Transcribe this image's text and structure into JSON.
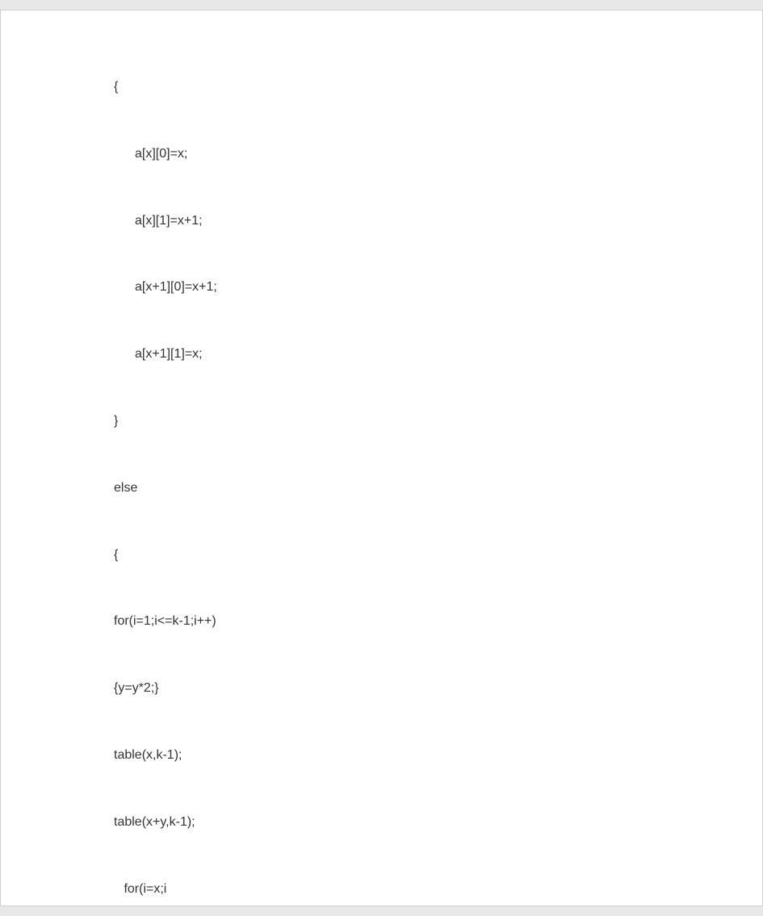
{
  "code": {
    "lines": [
      {
        "text": "{",
        "indent": "indent-0"
      },
      {
        "text": "a[x][0]=x;",
        "indent": "indent-1"
      },
      {
        "text": "a[x][1]=x+1;",
        "indent": "indent-1"
      },
      {
        "text": "a[x+1][0]=x+1;",
        "indent": "indent-1"
      },
      {
        "text": "a[x+1][1]=x;",
        "indent": "indent-1"
      },
      {
        "text": "}",
        "indent": "indent-0"
      },
      {
        "text": "else",
        "indent": "indent-0"
      },
      {
        "text": "{",
        "indent": "indent-0"
      },
      {
        "text": "for(i=1;i<=k-1;i++)",
        "indent": "indent-0"
      },
      {
        "text": "{y=y*2;}",
        "indent": "indent-0"
      },
      {
        "text": "table(x,k-1);",
        "indent": "indent-0"
      },
      {
        "text": "table(x+y,k-1);",
        "indent": "indent-0"
      },
      {
        "text": " for(i=x;i",
        "indent": "indent-05"
      }
    ]
  }
}
